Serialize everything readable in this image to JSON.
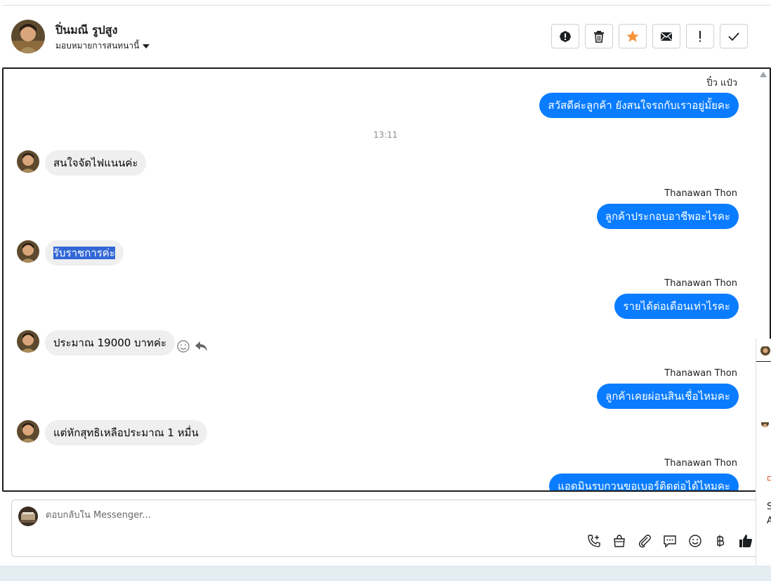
{
  "header": {
    "contact_name": "ปิ่นมณี รูปสูง",
    "assign_label": "มอบหมายการสนทนานี้"
  },
  "actions": [
    {
      "icon": "info-icon"
    },
    {
      "icon": "trash-icon"
    },
    {
      "icon": "star-icon",
      "color": "#f7923b"
    },
    {
      "icon": "envelope-icon"
    },
    {
      "icon": "exclamation-icon"
    },
    {
      "icon": "check-icon"
    }
  ],
  "thread": {
    "messages": [
      {
        "sender": "ปิ๋ว แป๋ว",
        "text": "สวัสดีค่ะลูกค้า ยังสนใจรถกับเราอยู่มั้ยคะ",
        "direction": "out"
      },
      {
        "time": "13:11"
      },
      {
        "text": "สนใจจัดไฟแนนค่ะ",
        "direction": "in"
      },
      {
        "sender": "Thanawan Thon",
        "text": "ลูกค้าประกอบอาชีพอะไรคะ",
        "direction": "out"
      },
      {
        "text": "รับราชการค่ะ",
        "direction": "in",
        "highlighted": true
      },
      {
        "sender": "Thanawan Thon",
        "text": "รายได้ต่อเดือนเท่าไรคะ",
        "direction": "out"
      },
      {
        "text": "ประมาณ 19000 บาทค่ะ",
        "direction": "in"
      },
      {
        "sender": "Thanawan Thon",
        "text": "ลูกค้าเคยผ่อนสินเชื่อไหมคะ",
        "direction": "out"
      },
      {
        "text": "แต่หักสุทธิเหลือประมาณ 1 หมื่น",
        "direction": "in"
      },
      {
        "sender": "Thanawan Thon",
        "text": "แอดมินรบกวนขอเบอร์ติดต่อได้ไหมคะ",
        "direction": "out"
      }
    ]
  },
  "composer": {
    "placeholder": "ตอบกลับใน Messenger...",
    "tools": [
      "phone-plus-icon",
      "shopping-bag-icon",
      "paperclip-icon",
      "saved-reply-icon",
      "emoji-icon",
      "baht-icon",
      "thumbs-up-icon"
    ]
  },
  "side_panel": {
    "text_1": "S",
    "text_2": "A"
  },
  "colors": {
    "outgoing_bubble": "#0a7cff",
    "incoming_bubble": "#efefef",
    "selection": "#3367d6"
  }
}
